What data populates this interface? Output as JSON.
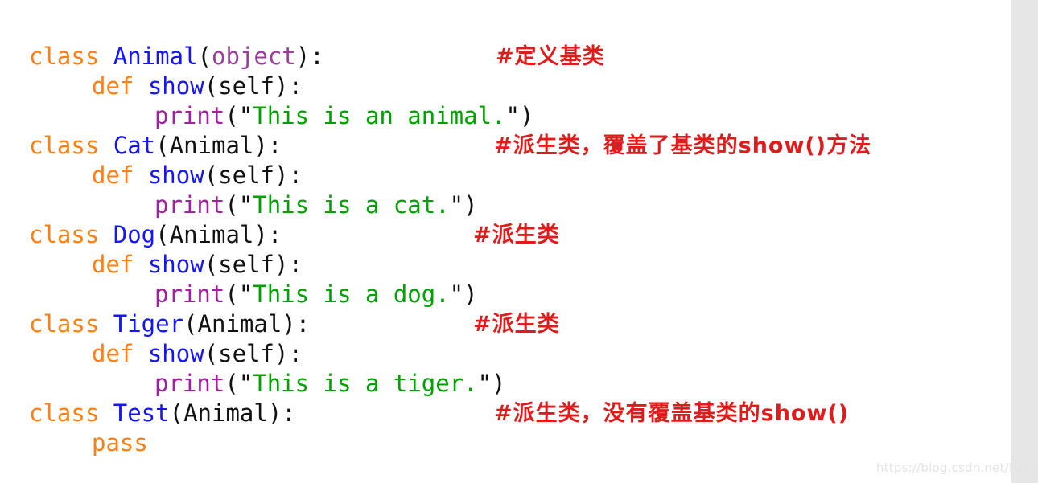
{
  "watermark": {
    "text": "https://blog.csdn.net/laqqgg"
  },
  "colors": {
    "background": "#ffffff",
    "gutter": "#e6e6e6",
    "keyword": "#ff7f11",
    "class_name": "#1414ff",
    "function_name": "#1414ff",
    "builtin": "#9b3d9b",
    "call": "#a020a0",
    "string": "#00a000",
    "punctuation": "#111111",
    "comment": "#e01b1b",
    "watermark": "#e4e4e4"
  },
  "code": {
    "language": "python",
    "lines": [
      {
        "indent": 0,
        "tokens": [
          {
            "kind": "keyword",
            "text": "class "
          },
          {
            "kind": "classname",
            "text": "Animal"
          },
          {
            "kind": "plain",
            "text": "("
          },
          {
            "kind": "builtin",
            "text": "object"
          },
          {
            "kind": "plain",
            "text": "):"
          }
        ],
        "comment": {
          "text": "#定义基类",
          "col": 580,
          "script": "cjk"
        }
      },
      {
        "indent": 1,
        "tokens": [
          {
            "kind": "keyword",
            "text": "def "
          },
          {
            "kind": "funcname",
            "text": "show"
          },
          {
            "kind": "plain",
            "text": "(self):"
          }
        ],
        "comment": null
      },
      {
        "indent": 2,
        "tokens": [
          {
            "kind": "call",
            "text": "print"
          },
          {
            "kind": "plain",
            "text": "(\""
          },
          {
            "kind": "string",
            "text": "This is an animal."
          },
          {
            "kind": "plain",
            "text": "\")"
          }
        ],
        "comment": null
      },
      {
        "indent": 0,
        "tokens": [
          {
            "kind": "keyword",
            "text": "class "
          },
          {
            "kind": "classname",
            "text": "Cat"
          },
          {
            "kind": "plain",
            "text": "(Animal):"
          }
        ],
        "comment": {
          "text": "#派生类，覆盖了基类的show()方法",
          "col": 578,
          "script": "cjk"
        }
      },
      {
        "indent": 1,
        "tokens": [
          {
            "kind": "keyword",
            "text": "def "
          },
          {
            "kind": "funcname",
            "text": "show"
          },
          {
            "kind": "plain",
            "text": "(self):"
          }
        ],
        "comment": null
      },
      {
        "indent": 2,
        "tokens": [
          {
            "kind": "call",
            "text": "print"
          },
          {
            "kind": "plain",
            "text": "(\""
          },
          {
            "kind": "string",
            "text": "This is a cat."
          },
          {
            "kind": "plain",
            "text": "\")"
          }
        ],
        "comment": null
      },
      {
        "indent": 0,
        "tokens": [
          {
            "kind": "keyword",
            "text": "class "
          },
          {
            "kind": "classname",
            "text": "Dog"
          },
          {
            "kind": "plain",
            "text": "(Animal):"
          }
        ],
        "comment": {
          "text": "#派生类",
          "col": 552,
          "script": "cjk"
        }
      },
      {
        "indent": 1,
        "tokens": [
          {
            "kind": "keyword",
            "text": "def "
          },
          {
            "kind": "funcname",
            "text": "show"
          },
          {
            "kind": "plain",
            "text": "(self):"
          }
        ],
        "comment": null
      },
      {
        "indent": 2,
        "tokens": [
          {
            "kind": "call",
            "text": "print"
          },
          {
            "kind": "plain",
            "text": "(\""
          },
          {
            "kind": "string",
            "text": "This is a dog."
          },
          {
            "kind": "plain",
            "text": "\")"
          }
        ],
        "comment": null
      },
      {
        "indent": 0,
        "tokens": [
          {
            "kind": "keyword",
            "text": "class "
          },
          {
            "kind": "classname",
            "text": "Tiger"
          },
          {
            "kind": "plain",
            "text": "(Animal):"
          }
        ],
        "comment": {
          "text": "#派生类",
          "col": 552,
          "script": "cjk"
        }
      },
      {
        "indent": 1,
        "tokens": [
          {
            "kind": "keyword",
            "text": "def "
          },
          {
            "kind": "funcname",
            "text": "show"
          },
          {
            "kind": "plain",
            "text": "(self):"
          }
        ],
        "comment": null
      },
      {
        "indent": 2,
        "tokens": [
          {
            "kind": "call",
            "text": "print"
          },
          {
            "kind": "plain",
            "text": "(\""
          },
          {
            "kind": "string",
            "text": "This is a tiger."
          },
          {
            "kind": "plain",
            "text": "\")"
          }
        ],
        "comment": null
      },
      {
        "indent": 0,
        "tokens": [
          {
            "kind": "keyword",
            "text": "class "
          },
          {
            "kind": "classname",
            "text": "Test"
          },
          {
            "kind": "plain",
            "text": "(Animal):"
          }
        ],
        "comment": {
          "text": "#派生类，没有覆盖基类的show()",
          "col": 578,
          "script": "cjk"
        }
      },
      {
        "indent": 1,
        "tokens": [
          {
            "kind": "keyword",
            "text": "pass"
          }
        ],
        "comment": null
      }
    ]
  }
}
